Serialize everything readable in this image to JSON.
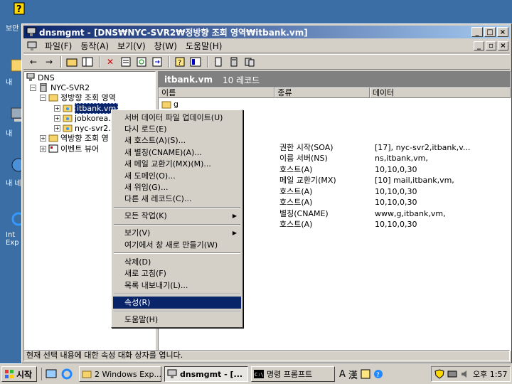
{
  "desktop": {
    "icons": [
      {
        "label": "보안",
        "top": 0
      },
      {
        "label": "내",
        "top": 0
      },
      {
        "label": "내",
        "top": 0
      },
      {
        "label": "내 네",
        "top": 0
      },
      {
        "label": "Int Exp",
        "top": 0
      }
    ]
  },
  "window": {
    "title": "dnsmgmt - [DNS₩NYC-SVR2₩정방향 조회 영역₩itbank.vm]",
    "menus": [
      "파일(F)",
      "동작(A)",
      "보기(V)",
      "창(W)",
      "도움말(H)"
    ]
  },
  "tree": {
    "root": "DNS",
    "server": "NYC-SVR2",
    "forward_zones": "정방향 조회 영역",
    "zone1": "itbank.vm",
    "zone2": "jobkorea.v",
    "zone3": "nyc-svr2.",
    "reverse_zones": "역방향 조회 영",
    "event_viewer": "이벤트 뷰어"
  },
  "list": {
    "header_title": "itbank.vm",
    "header_count": "10 레코드",
    "columns": [
      "이름",
      "종류",
      "데이터"
    ],
    "rows": [
      {
        "name": "g",
        "type": "",
        "data": ""
      },
      {
        "name": "",
        "type": "권한 시작(SOA)",
        "data": "[17], nyc-svr2,itbank,v..."
      },
      {
        "name": "",
        "type": "이름 서버(NS)",
        "data": "ns,itbank,vm,"
      },
      {
        "name": "",
        "type": "호스트(A)",
        "data": "10,10,0,30"
      },
      {
        "name": "",
        "type": "메일 교환기(MX)",
        "data": "[10]  mail,itbank,vm,"
      },
      {
        "name": "",
        "type": "호스트(A)",
        "data": "10,10,0,30"
      },
      {
        "name": "",
        "type": "호스트(A)",
        "data": "10,10,0,30"
      },
      {
        "name": "",
        "type": "별칭(CNAME)",
        "data": "www,g,itbank,vm,"
      },
      {
        "name": "",
        "type": "호스트(A)",
        "data": "10,10,0,30"
      }
    ]
  },
  "status": "현재 선택 내용에 대한 속성 대화 상자를 엽니다.",
  "context_menu": {
    "items": [
      "서버 데이터 파일 업데이트(U)",
      "다시 로드(E)",
      "새 호스트(A)(S)...",
      "새 별칭(CNAME)(A)...",
      "새 메일 교환기(MX)(M)...",
      "새 도메인(O)...",
      "새 위임(G)...",
      "다른 새 레코드(C)...",
      "모든 작업(K)",
      "보기(V)",
      "여기에서 창 새로 만들기(W)",
      "삭제(D)",
      "새로 고침(F)",
      "목록 내보내기(L)...",
      "속성(R)",
      "도움말(H)"
    ]
  },
  "taskbar": {
    "start": "시작",
    "tasks": [
      "2 Windows Exp...",
      "dnsmgmt - [...",
      "명령 프롬프트"
    ],
    "lang": [
      "A",
      "漢"
    ],
    "clock": "오후 1:57"
  }
}
